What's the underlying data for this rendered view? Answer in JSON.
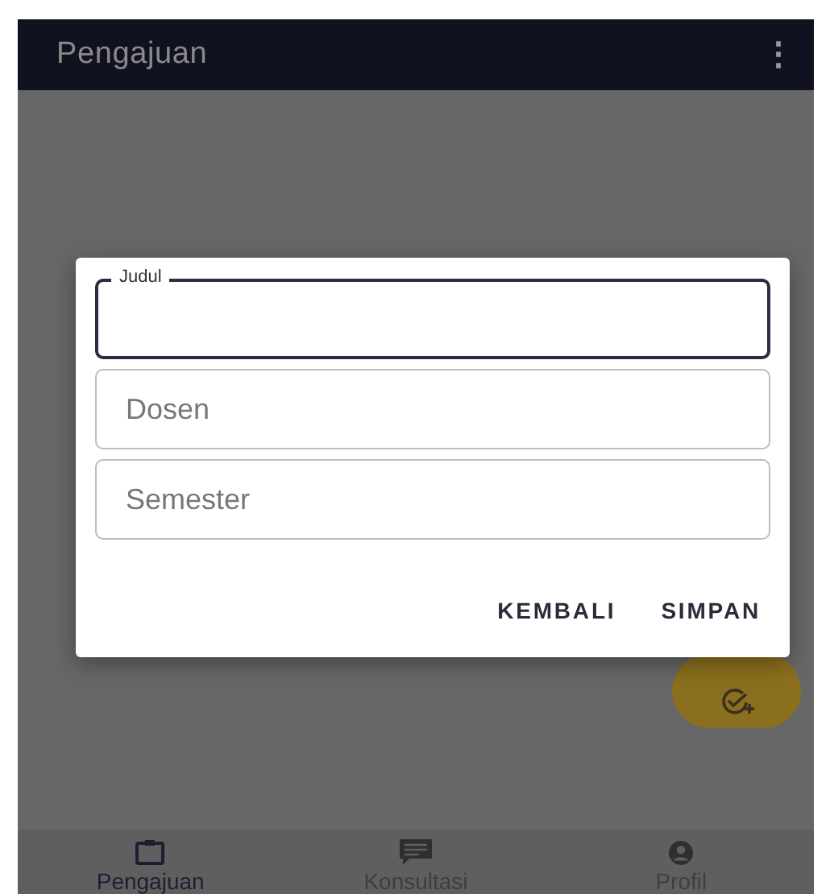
{
  "app_bar": {
    "title": "Pengajuan",
    "menu": "⋮"
  },
  "dialog": {
    "fields": [
      {
        "label": "Judul",
        "focused": true
      },
      {
        "placeholder": "Dosen",
        "focused": false
      },
      {
        "placeholder": "Semester",
        "focused": false
      }
    ],
    "buttons": [
      "KEMBALI",
      "SIMPAN"
    ]
  },
  "bottom_nav": [
    {
      "label": "Pengajuan",
      "kind": "clipboard",
      "selected": true
    },
    {
      "label": "Konsultasi",
      "kind": "chat",
      "selected": false
    },
    {
      "label": "Profil",
      "kind": "profile",
      "selected": false
    }
  ]
}
